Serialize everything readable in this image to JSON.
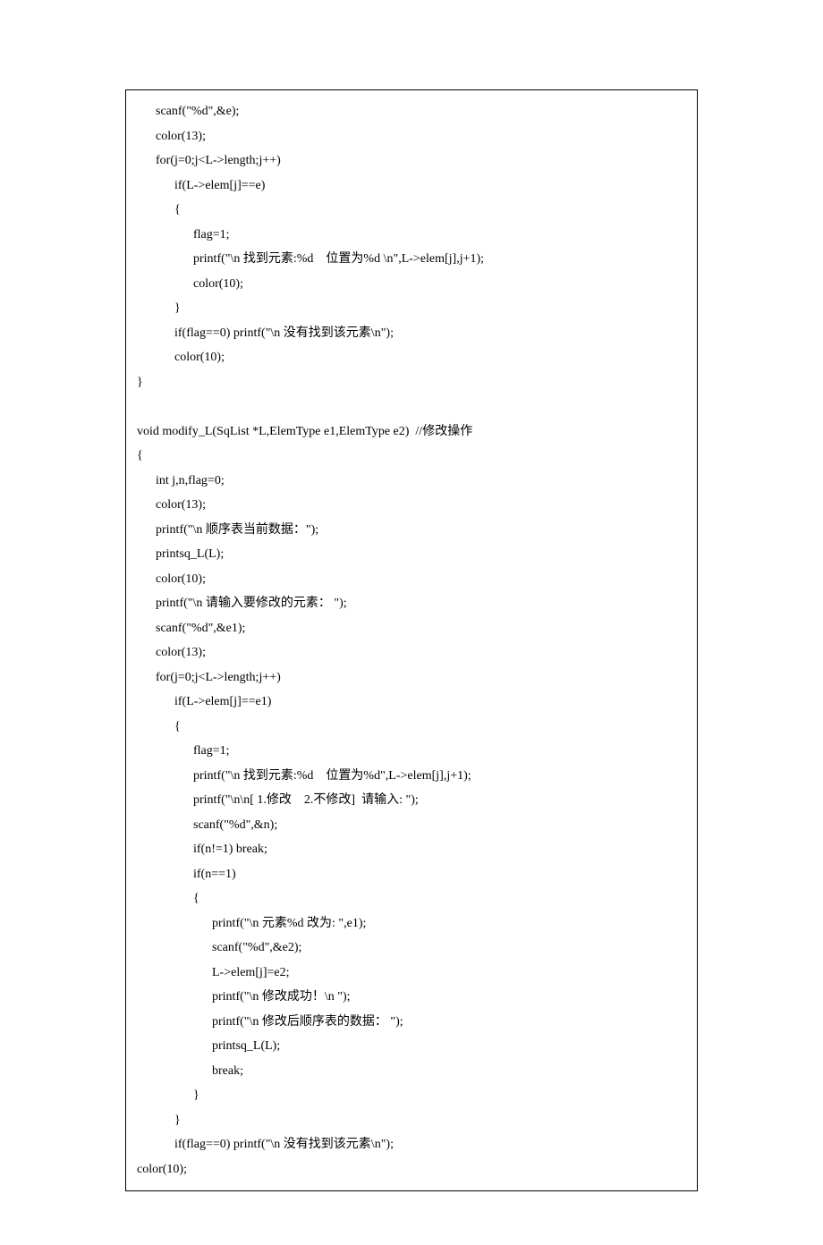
{
  "code": {
    "lines": [
      "      scanf(\"%d\",&e);",
      "      color(13);",
      "      for(j=0;j<L->length;j++)",
      "            if(L->elem[j]==e)",
      "            {",
      "                  flag=1;",
      "                  printf(\"\\n 找到元素:%d    位置为%d \\n\",L->elem[j],j+1);",
      "                  color(10);",
      "            }",
      "            if(flag==0) printf(\"\\n 没有找到该元素\\n\");",
      "            color(10);",
      "}",
      "",
      "void modify_L(SqList *L,ElemType e1,ElemType e2)  //修改操作",
      "{",
      "      int j,n,flag=0;",
      "      color(13);",
      "      printf(\"\\n 顺序表当前数据：\");",
      "      printsq_L(L);",
      "      color(10);",
      "      printf(\"\\n 请输入要修改的元素： \");",
      "      scanf(\"%d\",&e1);",
      "      color(13);",
      "      for(j=0;j<L->length;j++)",
      "            if(L->elem[j]==e1)",
      "            {",
      "                  flag=1;",
      "                  printf(\"\\n 找到元素:%d    位置为%d\",L->elem[j],j+1);",
      "                  printf(\"\\n\\n[ 1.修改    2.不修改]  请输入: \");",
      "                  scanf(\"%d\",&n);",
      "                  if(n!=1) break;",
      "                  if(n==1)",
      "                  {",
      "                        printf(\"\\n 元素%d 改为: \",e1);",
      "                        scanf(\"%d\",&e2);",
      "                        L->elem[j]=e2;",
      "                        printf(\"\\n 修改成功！\\n \");",
      "                        printf(\"\\n 修改后顺序表的数据： \");",
      "                        printsq_L(L);",
      "                        break;",
      "                  }",
      "            }",
      "            if(flag==0) printf(\"\\n 没有找到该元素\\n\");",
      "color(10);"
    ]
  }
}
